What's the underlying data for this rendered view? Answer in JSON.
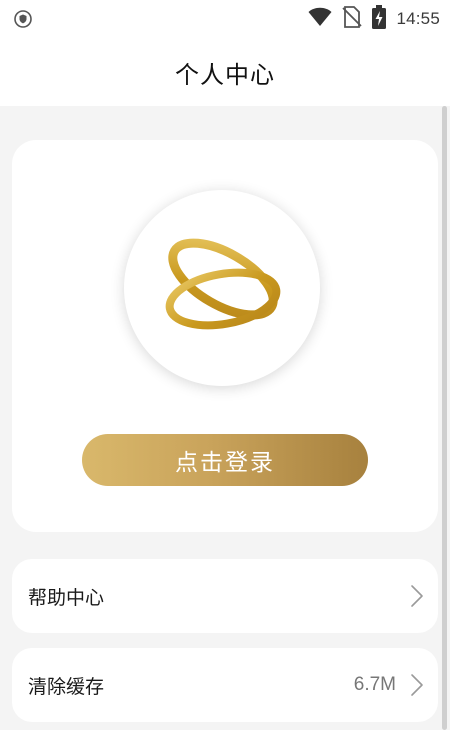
{
  "status_bar": {
    "left_icon": "shield-icon",
    "wifi_icon": "wifi-icon",
    "signal_icon": "no-signal-icon",
    "battery_icon": "battery-charging-icon",
    "time": "14:55"
  },
  "header": {
    "title": "个人中心"
  },
  "profile": {
    "avatar_icon": "ring-logo-icon",
    "login_button_label": "点击登录"
  },
  "menu": {
    "items": [
      {
        "label": "帮助中心",
        "value": "",
        "icon": "chevron-right-icon"
      },
      {
        "label": "清除缓存",
        "value": "6.7M",
        "icon": "chevron-right-icon"
      }
    ]
  },
  "colors": {
    "accent_gold": "#c9a35b",
    "accent_gold_dark": "#a7813e",
    "background": "#f4f4f4",
    "card": "#ffffff"
  }
}
